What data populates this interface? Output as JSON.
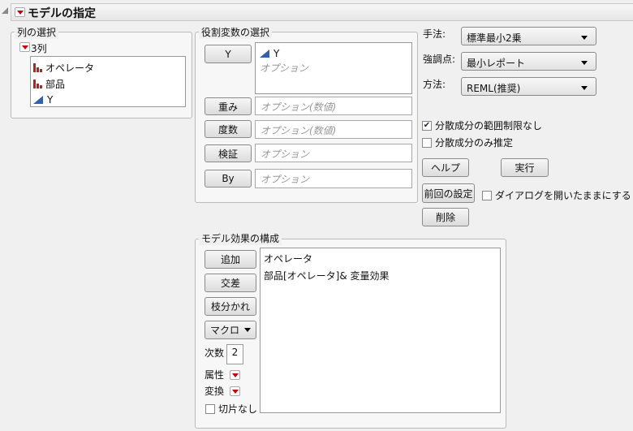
{
  "header": {
    "title": "モデルの指定"
  },
  "column_select": {
    "label": "列の選択",
    "count_label": "3列",
    "columns": [
      {
        "name": "オペレータ",
        "type": "nominal"
      },
      {
        "name": "部品",
        "type": "nominal"
      },
      {
        "name": "Y",
        "type": "continuous"
      }
    ]
  },
  "roles": {
    "label": "役割変数の選択",
    "y": {
      "button": "Y",
      "values": [
        "Y"
      ],
      "placeholder": "オプション"
    },
    "weight": {
      "button": "重み",
      "placeholder": "オプション(数値)"
    },
    "freq": {
      "button": "度数",
      "placeholder": "オプション(数値)"
    },
    "validation": {
      "button": "検証",
      "placeholder": "オプション"
    },
    "by": {
      "button": "By",
      "placeholder": "オプション"
    }
  },
  "options": {
    "personality": {
      "label": "手法:",
      "value": "標準最小2乗"
    },
    "emphasis": {
      "label": "強調点:",
      "value": "最小レポート"
    },
    "method": {
      "label": "方法:",
      "value": "REML(推奨)"
    },
    "unbounded": {
      "label": "分散成分の範囲制限なし",
      "checked": true
    },
    "variance_only": {
      "label": "分散成分のみ推定",
      "checked": false
    },
    "help": "ヘルプ",
    "run": "実行",
    "recall": "前回の設定",
    "keep_open": {
      "label": "ダイアログを開いたままにする",
      "checked": false
    },
    "remove": "削除"
  },
  "effects": {
    "label": "モデル効果の構成",
    "add": "追加",
    "cross": "交差",
    "nest": "枝分かれ",
    "macros": "マクロ",
    "degree_label": "次数",
    "degree": "2",
    "attributes": "属性",
    "transform": "変換",
    "no_intercept": {
      "label": "切片なし",
      "checked": false
    },
    "items": [
      "オペレータ",
      "部品[オペレータ]& 変量効果"
    ]
  }
}
